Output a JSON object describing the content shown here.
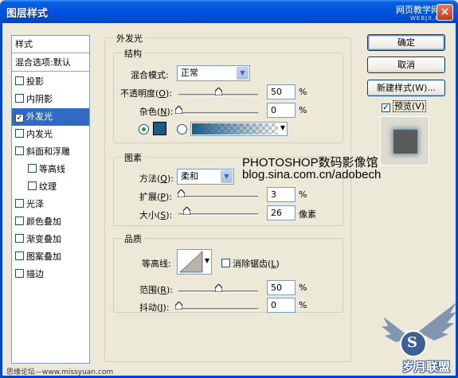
{
  "window": {
    "title": "图层样式",
    "watermark_top": "网页教学网",
    "watermark_top_small": "WEBJX.COM",
    "close_glyph": "×"
  },
  "styles_list": {
    "header": "样式",
    "blend_options": "混合选项:默认",
    "items": [
      {
        "label": "投影",
        "checked": false
      },
      {
        "label": "内阴影",
        "checked": false
      },
      {
        "label": "外发光",
        "checked": true,
        "selected": true
      },
      {
        "label": "内发光",
        "checked": false
      },
      {
        "label": "斜面和浮雕",
        "checked": false
      },
      {
        "label": "等高线",
        "checked": false,
        "indent": true
      },
      {
        "label": "纹理",
        "checked": false,
        "indent": true
      },
      {
        "label": "光泽",
        "checked": false
      },
      {
        "label": "颜色叠加",
        "checked": false
      },
      {
        "label": "渐变叠加",
        "checked": false
      },
      {
        "label": "图案叠加",
        "checked": false
      },
      {
        "label": "描边",
        "checked": false
      }
    ]
  },
  "outer_glow": {
    "title": "外发光",
    "structure": {
      "title": "结构",
      "blend_mode_label": "混合模式:",
      "blend_mode_value": "正常",
      "opacity_label": "不透明度",
      "opacity_key": "O",
      "opacity_value": "50",
      "opacity_level": 0.5,
      "noise_label": "杂色",
      "noise_key": "N",
      "noise_value": "0",
      "noise_level": 0,
      "percent": "%",
      "color_swatch": "#1a5a8a"
    },
    "elements": {
      "title": "图素",
      "method_label": "方法",
      "method_key": "Q",
      "method_value": "柔和",
      "spread_label": "扩展",
      "spread_key": "P",
      "spread_value": "3",
      "spread_level": 0.03,
      "size_label": "大小",
      "size_key": "S",
      "size_value": "26",
      "size_level": 0.104,
      "percent": "%",
      "pixels": "像素"
    },
    "quality": {
      "title": "品质",
      "contour_label": "等高线:",
      "antialias_label": "消除锯齿",
      "antialias_key": "L",
      "antialias_checked": false,
      "range_label": "范围",
      "range_key": "R",
      "range_value": "50",
      "range_level": 0.5,
      "jitter_label": "抖动",
      "jitter_key": "J",
      "jitter_value": "0",
      "jitter_level": 0,
      "percent": "%"
    }
  },
  "buttons": {
    "ok": "确定",
    "cancel": "取消",
    "new_style": "新建样式(W)...",
    "preview_label": "预览(V)",
    "preview_checked": true
  },
  "overlay": {
    "line1": "PHOTOSHOP数码影像馆",
    "line2": "blog.sina.com.cn/adobech",
    "footer": "思缘论坛—www.missyuan.com",
    "badge_letter": "S",
    "badge_text": "岁月联盟"
  },
  "colors": {
    "titlebar": "#0054e3",
    "selection": "#316ac5",
    "glow_swatch": "#1a5a8a"
  }
}
